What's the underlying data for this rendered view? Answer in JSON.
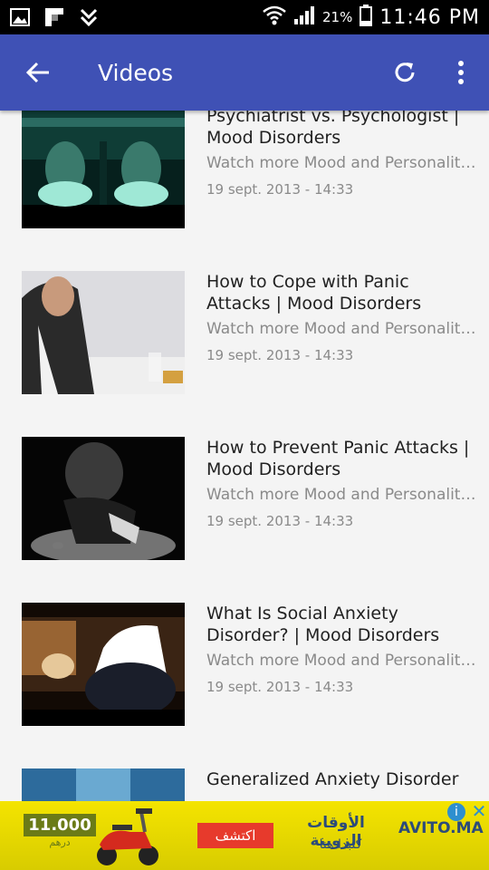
{
  "statusbar": {
    "battery": "21%",
    "time": "11:46 PM"
  },
  "appbar": {
    "title": "Videos"
  },
  "videos": [
    {
      "title": "Psychiatrist vs. Psychologist | Mood Disorders",
      "description": "Watch more Mood and Personality Disorders videos:...",
      "date": "19 sept. 2013 - 14:33"
    },
    {
      "title": "How to Cope with Panic Attacks | Mood Disorders",
      "description": "Watch more Mood and Personality Disorders videos:...",
      "date": "19 sept. 2013 - 14:33"
    },
    {
      "title": "How to Prevent Panic Attacks | Mood Disorders",
      "description": "Watch more Mood and Personality Disorders videos:...",
      "date": "19 sept. 2013 - 14:33"
    },
    {
      "title": "What Is Social Anxiety Disorder? | Mood Disorders",
      "description": "Watch more Mood and Personality Disorders videos:...",
      "date": "19 sept. 2013 - 14:33"
    },
    {
      "title": "Generalized Anxiety Disorder"
    }
  ],
  "ad": {
    "price": "11.000",
    "currency": "درهم",
    "cta": "اكتشف",
    "headline": "الأوقات الزوينة",
    "subline": "كتبدا هنا",
    "brand": "AVITO.MA"
  },
  "colors": {
    "appbar": "#3f51b5",
    "background": "#f4f4f4"
  }
}
